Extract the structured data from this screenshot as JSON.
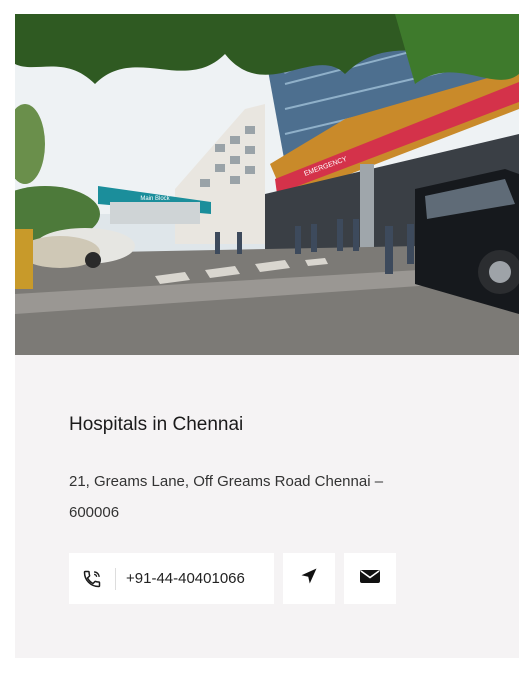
{
  "listing": {
    "image_alt": "Hospital building entrance with Main Block and Emergency signage",
    "title": "Hospitals in Chennai",
    "address": "21, Greams Lane, Off Greams Road Chennai – 600006",
    "phone": "+91-44-40401066",
    "sign_main": "Main Block",
    "sign_emergency": "EMERGENCY"
  },
  "icons": {
    "phone": "phone-icon",
    "directions": "navigation-arrow-icon",
    "email": "envelope-icon"
  },
  "colors": {
    "card_bg": "#f5f3f4",
    "text": "#1b1b1b",
    "button_bg": "#ffffff"
  }
}
